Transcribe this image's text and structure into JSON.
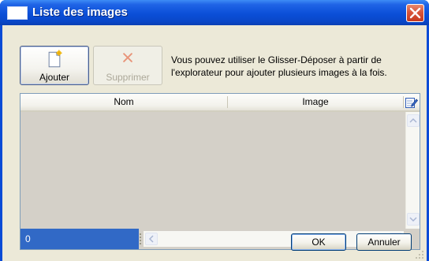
{
  "window": {
    "title": "Liste des images"
  },
  "toolbar": {
    "add_label": "Ajouter",
    "remove_label": "Supprimer",
    "hint": "Vous pouvez utiliser le Glisser-Déposer à partir de l'explorateur pour ajouter plusieurs images à la fois."
  },
  "grid": {
    "columns": [
      "Nom",
      "Image"
    ],
    "rows": [],
    "count": "0"
  },
  "buttons": {
    "ok": "OK",
    "cancel": "Annuler"
  },
  "colors": {
    "titlebar": "#0b4fd8",
    "dialog_bg": "#ece9d8",
    "grid_bg": "#d4d0c8",
    "selection": "#3169c6",
    "close_button": "#d9553a"
  },
  "icons": {
    "window": "window-icon",
    "close": "close-icon",
    "add": "new-document-icon",
    "remove": "red-x-icon",
    "edit_column": "edit-column-icon"
  }
}
